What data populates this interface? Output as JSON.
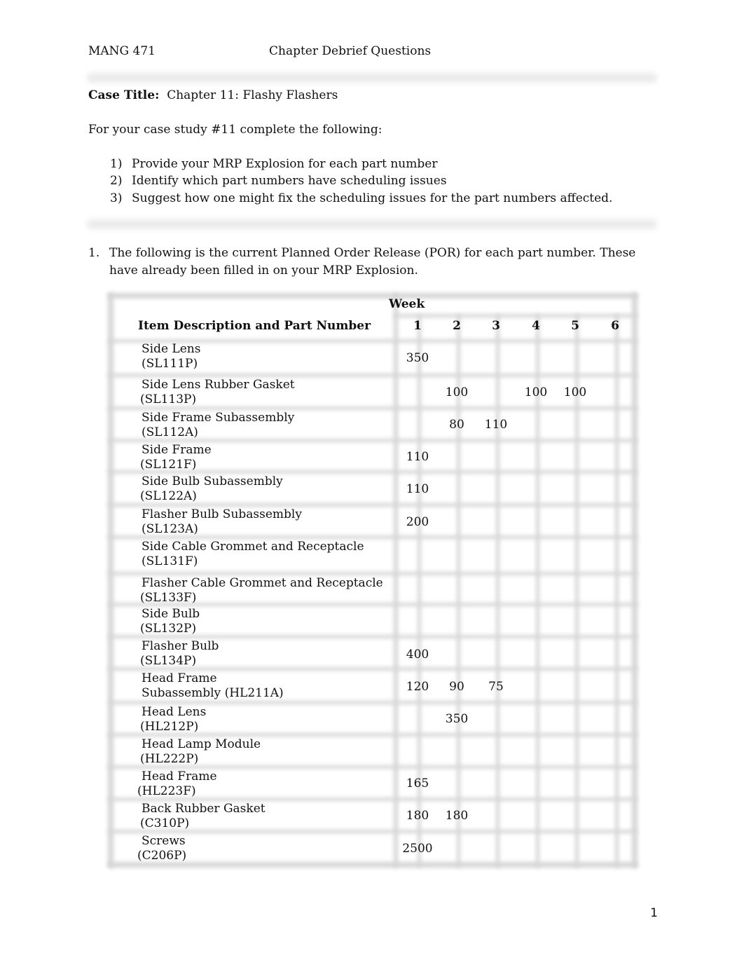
{
  "header": {
    "course": "MANG 471",
    "title": "Chapter Debrief Questions"
  },
  "case": {
    "label": "Case Title:",
    "title": "Chapter 11: Flashy Flashers"
  },
  "intro": "For your case study #11 complete the following:",
  "tasks": [
    {
      "num": "1)",
      "text": "Provide your MRP Explosion for each part number"
    },
    {
      "num": "2)",
      "text": "Identify which part numbers have scheduling issues"
    },
    {
      "num": "3)",
      "text": "Suggest how one might fix the scheduling issues for the part numbers affected."
    }
  ],
  "question1": {
    "num": "1.",
    "text": "The following is the current Planned Order Release (POR) for each part number. These have already been filled in on your MRP Explosion."
  },
  "table": {
    "week_label": "Week",
    "item_header": "Item Description and Part Number",
    "weeks": [
      "1",
      "2",
      "3",
      "4",
      "5",
      "6"
    ],
    "rows": [
      {
        "desc": "Side Lens",
        "part": "(SL111P)",
        "values": [
          "350",
          "",
          "",
          "",
          "",
          ""
        ]
      },
      {
        "desc": "Side Lens Rubber Gasket",
        "part": "(SL113P)",
        "values": [
          "",
          "100",
          "",
          "100",
          "100",
          ""
        ]
      },
      {
        "desc": "Side Frame Subassembly",
        "part": "(SL112A)",
        "values": [
          "",
          "80",
          "110",
          "",
          "",
          ""
        ]
      },
      {
        "desc": "Side Frame",
        "part": "(SL121F)",
        "values": [
          "110",
          "",
          "",
          "",
          "",
          ""
        ]
      },
      {
        "desc": "Side Bulb Subassembly",
        "part": "(SL122A)",
        "values": [
          "110",
          "",
          "",
          "",
          "",
          ""
        ]
      },
      {
        "desc": "Flasher Bulb Subassembly",
        "part": "(SL123A)",
        "values": [
          "200",
          "",
          "",
          "",
          "",
          ""
        ]
      },
      {
        "desc": "Side Cable Grommet and Receptacle",
        "part": "(SL131F)",
        "values": [
          "",
          "",
          "",
          "",
          "",
          ""
        ]
      },
      {
        "desc": "Flasher Cable Grommet and Receptacle",
        "part": "(SL133F)",
        "values": [
          "",
          "",
          "",
          "",
          "",
          ""
        ]
      },
      {
        "desc": "Side Bulb",
        "part": "(SL132P)",
        "values": [
          "",
          "",
          "",
          "",
          "",
          ""
        ]
      },
      {
        "desc": "Flasher Bulb",
        "part": "(SL134P)",
        "values": [
          "400",
          "",
          "",
          "",
          "",
          ""
        ]
      },
      {
        "desc": "Head Frame",
        "part": "Subassembly (HL211A)",
        "values": [
          "120",
          "90",
          "75",
          "",
          "",
          ""
        ]
      },
      {
        "desc": "Head Lens",
        "part": "(HL212P)",
        "values": [
          "",
          "350",
          "",
          "",
          "",
          ""
        ]
      },
      {
        "desc": "Head Lamp Module",
        "part": "(HL222P)",
        "values": [
          "",
          "",
          "",
          "",
          "",
          ""
        ]
      },
      {
        "desc": "Head Frame",
        "part": "(HL223F)",
        "values": [
          "165",
          "",
          "",
          "",
          "",
          ""
        ]
      },
      {
        "desc": "Back Rubber Gasket",
        "part": "(C310P)",
        "values": [
          "180",
          "180",
          "",
          "",
          "",
          ""
        ]
      },
      {
        "desc": "Screws",
        "part": "(C206P)",
        "values": [
          "2500",
          "",
          "",
          "",
          "",
          ""
        ]
      }
    ]
  },
  "page_number": "1"
}
